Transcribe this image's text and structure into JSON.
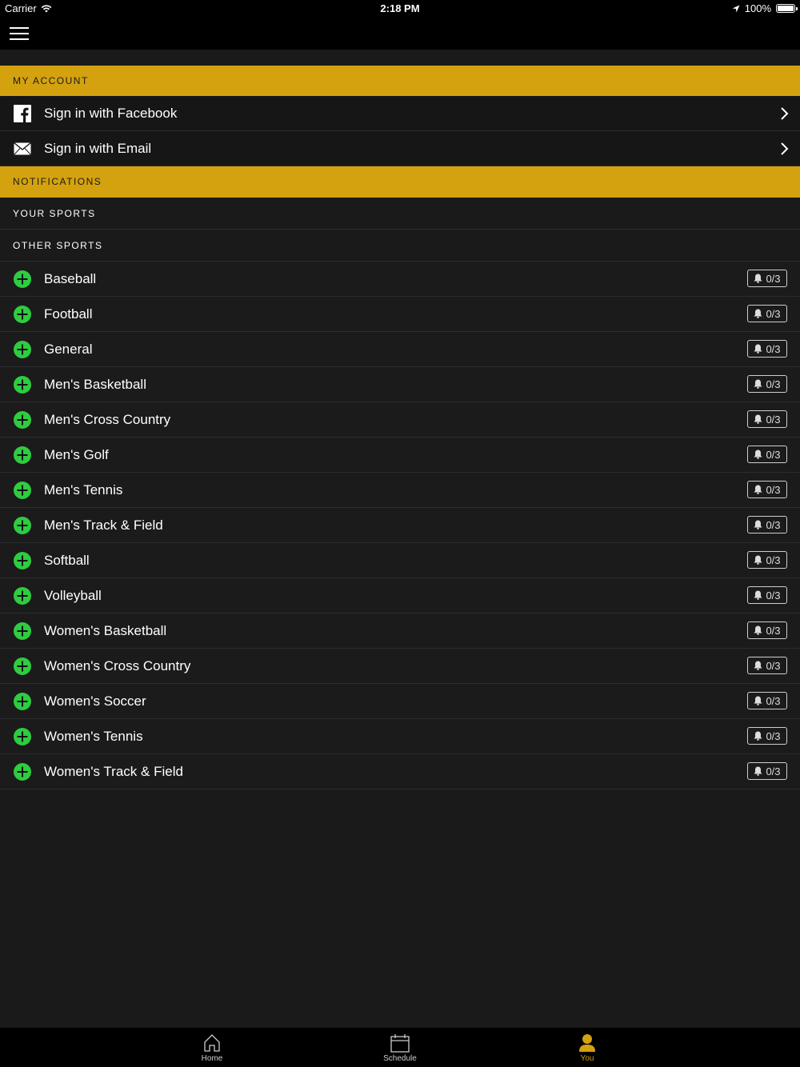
{
  "status": {
    "carrier": "Carrier",
    "time": "2:18 PM",
    "battery": "100%"
  },
  "account": {
    "header": "MY ACCOUNT",
    "facebook_label": "Sign in with Facebook",
    "email_label": "Sign in with Email"
  },
  "notifications": {
    "header": "NOTIFICATIONS",
    "your_sports": "YOUR SPORTS",
    "other_sports": "OTHER SPORTS"
  },
  "sports": [
    {
      "name": "Baseball",
      "count": "0/3"
    },
    {
      "name": "Football",
      "count": "0/3"
    },
    {
      "name": "General",
      "count": "0/3"
    },
    {
      "name": "Men's Basketball",
      "count": "0/3"
    },
    {
      "name": "Men's Cross Country",
      "count": "0/3"
    },
    {
      "name": "Men's Golf",
      "count": "0/3"
    },
    {
      "name": "Men's Tennis",
      "count": "0/3"
    },
    {
      "name": "Men's Track & Field",
      "count": "0/3"
    },
    {
      "name": "Softball",
      "count": "0/3"
    },
    {
      "name": "Volleyball",
      "count": "0/3"
    },
    {
      "name": "Women's Basketball",
      "count": "0/3"
    },
    {
      "name": "Women's Cross Country",
      "count": "0/3"
    },
    {
      "name": "Women's Soccer",
      "count": "0/3"
    },
    {
      "name": "Women's Tennis",
      "count": "0/3"
    },
    {
      "name": "Women's Track & Field",
      "count": "0/3"
    }
  ],
  "tabs": {
    "home": "Home",
    "schedule": "Schedule",
    "you": "You"
  },
  "colors": {
    "accent": "#d4a20e",
    "add_green": "#2ecc40",
    "background": "#1a1a1a"
  },
  "icons": {
    "menu": "hamburger-menu-icon",
    "facebook": "facebook-icon",
    "email": "envelope-icon",
    "add": "plus-circle-icon",
    "bell": "bell-icon",
    "home": "home-icon",
    "schedule": "calendar-icon",
    "you": "person-icon"
  }
}
